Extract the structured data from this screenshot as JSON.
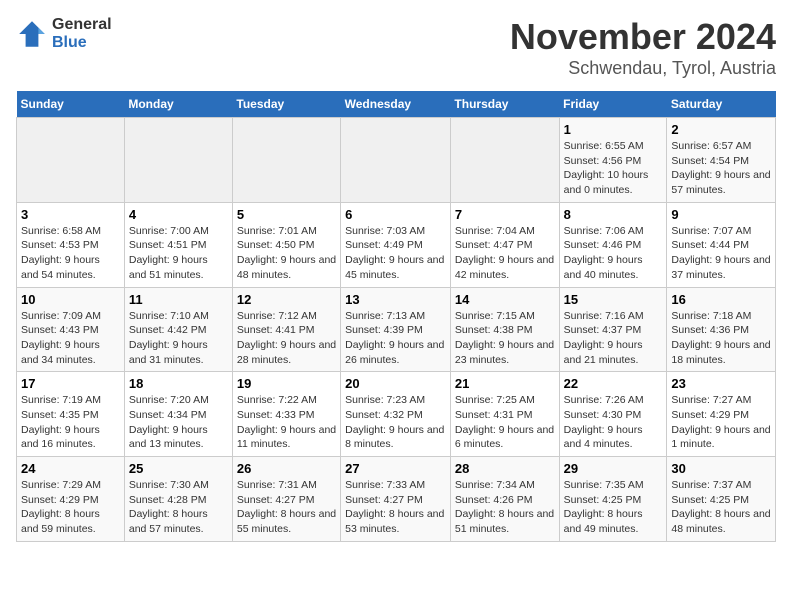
{
  "logo": {
    "general": "General",
    "blue": "Blue"
  },
  "title": {
    "month": "November 2024",
    "location": "Schwendau, Tyrol, Austria"
  },
  "weekdays": [
    "Sunday",
    "Monday",
    "Tuesday",
    "Wednesday",
    "Thursday",
    "Friday",
    "Saturday"
  ],
  "weeks": [
    [
      {
        "day": "",
        "info": ""
      },
      {
        "day": "",
        "info": ""
      },
      {
        "day": "",
        "info": ""
      },
      {
        "day": "",
        "info": ""
      },
      {
        "day": "",
        "info": ""
      },
      {
        "day": "1",
        "info": "Sunrise: 6:55 AM\nSunset: 4:56 PM\nDaylight: 10 hours and 0 minutes."
      },
      {
        "day": "2",
        "info": "Sunrise: 6:57 AM\nSunset: 4:54 PM\nDaylight: 9 hours and 57 minutes."
      }
    ],
    [
      {
        "day": "3",
        "info": "Sunrise: 6:58 AM\nSunset: 4:53 PM\nDaylight: 9 hours and 54 minutes."
      },
      {
        "day": "4",
        "info": "Sunrise: 7:00 AM\nSunset: 4:51 PM\nDaylight: 9 hours and 51 minutes."
      },
      {
        "day": "5",
        "info": "Sunrise: 7:01 AM\nSunset: 4:50 PM\nDaylight: 9 hours and 48 minutes."
      },
      {
        "day": "6",
        "info": "Sunrise: 7:03 AM\nSunset: 4:49 PM\nDaylight: 9 hours and 45 minutes."
      },
      {
        "day": "7",
        "info": "Sunrise: 7:04 AM\nSunset: 4:47 PM\nDaylight: 9 hours and 42 minutes."
      },
      {
        "day": "8",
        "info": "Sunrise: 7:06 AM\nSunset: 4:46 PM\nDaylight: 9 hours and 40 minutes."
      },
      {
        "day": "9",
        "info": "Sunrise: 7:07 AM\nSunset: 4:44 PM\nDaylight: 9 hours and 37 minutes."
      }
    ],
    [
      {
        "day": "10",
        "info": "Sunrise: 7:09 AM\nSunset: 4:43 PM\nDaylight: 9 hours and 34 minutes."
      },
      {
        "day": "11",
        "info": "Sunrise: 7:10 AM\nSunset: 4:42 PM\nDaylight: 9 hours and 31 minutes."
      },
      {
        "day": "12",
        "info": "Sunrise: 7:12 AM\nSunset: 4:41 PM\nDaylight: 9 hours and 28 minutes."
      },
      {
        "day": "13",
        "info": "Sunrise: 7:13 AM\nSunset: 4:39 PM\nDaylight: 9 hours and 26 minutes."
      },
      {
        "day": "14",
        "info": "Sunrise: 7:15 AM\nSunset: 4:38 PM\nDaylight: 9 hours and 23 minutes."
      },
      {
        "day": "15",
        "info": "Sunrise: 7:16 AM\nSunset: 4:37 PM\nDaylight: 9 hours and 21 minutes."
      },
      {
        "day": "16",
        "info": "Sunrise: 7:18 AM\nSunset: 4:36 PM\nDaylight: 9 hours and 18 minutes."
      }
    ],
    [
      {
        "day": "17",
        "info": "Sunrise: 7:19 AM\nSunset: 4:35 PM\nDaylight: 9 hours and 16 minutes."
      },
      {
        "day": "18",
        "info": "Sunrise: 7:20 AM\nSunset: 4:34 PM\nDaylight: 9 hours and 13 minutes."
      },
      {
        "day": "19",
        "info": "Sunrise: 7:22 AM\nSunset: 4:33 PM\nDaylight: 9 hours and 11 minutes."
      },
      {
        "day": "20",
        "info": "Sunrise: 7:23 AM\nSunset: 4:32 PM\nDaylight: 9 hours and 8 minutes."
      },
      {
        "day": "21",
        "info": "Sunrise: 7:25 AM\nSunset: 4:31 PM\nDaylight: 9 hours and 6 minutes."
      },
      {
        "day": "22",
        "info": "Sunrise: 7:26 AM\nSunset: 4:30 PM\nDaylight: 9 hours and 4 minutes."
      },
      {
        "day": "23",
        "info": "Sunrise: 7:27 AM\nSunset: 4:29 PM\nDaylight: 9 hours and 1 minute."
      }
    ],
    [
      {
        "day": "24",
        "info": "Sunrise: 7:29 AM\nSunset: 4:29 PM\nDaylight: 8 hours and 59 minutes."
      },
      {
        "day": "25",
        "info": "Sunrise: 7:30 AM\nSunset: 4:28 PM\nDaylight: 8 hours and 57 minutes."
      },
      {
        "day": "26",
        "info": "Sunrise: 7:31 AM\nSunset: 4:27 PM\nDaylight: 8 hours and 55 minutes."
      },
      {
        "day": "27",
        "info": "Sunrise: 7:33 AM\nSunset: 4:27 PM\nDaylight: 8 hours and 53 minutes."
      },
      {
        "day": "28",
        "info": "Sunrise: 7:34 AM\nSunset: 4:26 PM\nDaylight: 8 hours and 51 minutes."
      },
      {
        "day": "29",
        "info": "Sunrise: 7:35 AM\nSunset: 4:25 PM\nDaylight: 8 hours and 49 minutes."
      },
      {
        "day": "30",
        "info": "Sunrise: 7:37 AM\nSunset: 4:25 PM\nDaylight: 8 hours and 48 minutes."
      }
    ]
  ]
}
